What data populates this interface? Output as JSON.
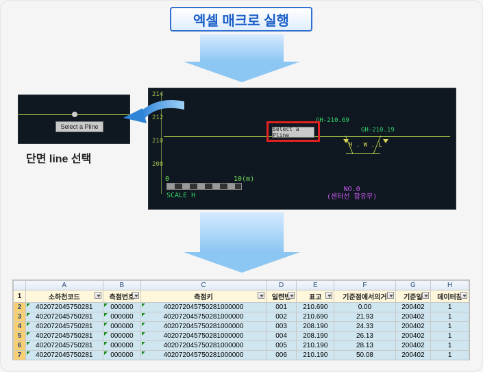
{
  "title": "엑셀 매크로 실행",
  "caption": "단면 line 선택",
  "cad": {
    "select_pline": "Select a Pline",
    "ticks": {
      "t0": "214",
      "t1": "212",
      "t2": "210",
      "t3": "208"
    },
    "gh1": "GH-210.69",
    "gh2": "GH-210.19",
    "hwl": "H . W . L",
    "scale_h": "SCALE  H",
    "scale_0": "0",
    "scale_10": "10(m)",
    "no0": "NO.0",
    "center": "(센터선 합유무)"
  },
  "excel": {
    "cols": [
      "A",
      "B",
      "C",
      "D",
      "E",
      "F",
      "G",
      "H"
    ],
    "headers": {
      "a": "소하천코드",
      "b": "측점번호",
      "c": "측점키",
      "d": "일련번",
      "e": "표고",
      "f": "기준점에서의거",
      "g": "기준일",
      "h": "데이터참"
    },
    "rows": [
      {
        "a": "402072045750281",
        "b": "000000",
        "c": "402072045750281000000",
        "d": "001",
        "e": "210.690",
        "f": "0.00",
        "g": "200402",
        "h": "1"
      },
      {
        "a": "402072045750281",
        "b": "000000",
        "c": "402072045750281000000",
        "d": "002",
        "e": "210.690",
        "f": "21.93",
        "g": "200402",
        "h": "1"
      },
      {
        "a": "402072045750281",
        "b": "000000",
        "c": "402072045750281000000",
        "d": "003",
        "e": "208.190",
        "f": "24.33",
        "g": "200402",
        "h": "1"
      },
      {
        "a": "402072045750281",
        "b": "000000",
        "c": "402072045750281000000",
        "d": "004",
        "e": "208.190",
        "f": "26.13",
        "g": "200402",
        "h": "1"
      },
      {
        "a": "402072045750281",
        "b": "000000",
        "c": "402072045750281000000",
        "d": "005",
        "e": "210.190",
        "f": "28.13",
        "g": "200402",
        "h": "1"
      },
      {
        "a": "402072045750281",
        "b": "000000",
        "c": "402072045750281000000",
        "d": "006",
        "e": "210.190",
        "f": "50.08",
        "g": "200402",
        "h": "1"
      }
    ]
  }
}
